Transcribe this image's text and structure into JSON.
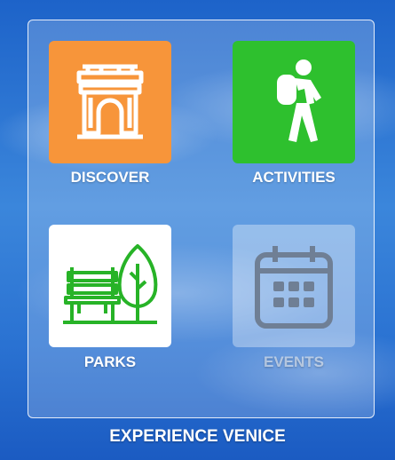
{
  "tiles": [
    {
      "label": "DISCOVER",
      "icon": "arch-icon",
      "color": "#f7953a"
    },
    {
      "label": "ACTIVITIES",
      "icon": "hiker-icon",
      "color": "#2ec02e"
    },
    {
      "label": "PARKS",
      "icon": "park-bench-tree-icon",
      "color": "#ffffff"
    },
    {
      "label": "EVENTS",
      "icon": "calendar-icon",
      "color": "#ffffff"
    }
  ],
  "footer": {
    "title": "EXPERIENCE VENICE"
  },
  "colors": {
    "icon_green": "#27b327",
    "events_icon": "#6f7f95"
  }
}
